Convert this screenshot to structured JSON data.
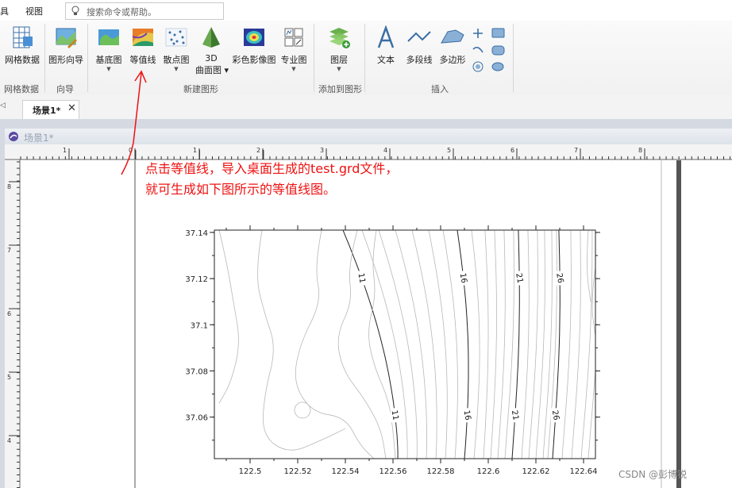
{
  "menu": {
    "item1": "具",
    "item2": "视图"
  },
  "search": {
    "placeholder": "搜索命令或帮助。"
  },
  "ribbon": {
    "grid_data": "网格数据",
    "graph_wizard": "图形向导",
    "basemap": "基底图",
    "contour": "等值线",
    "scatter": "散点图",
    "surface_line1": "3D",
    "surface_line2": "曲面图",
    "color_image": "彩色影像图",
    "special": "专业图",
    "layer": "图层",
    "text": "文本",
    "polyline": "多段线",
    "polygon": "多边形",
    "group_grid": "网格数据",
    "group_wizard": "向导",
    "group_new": "新建图形",
    "group_add": "添加到图形",
    "group_insert": "插入"
  },
  "tabs": {
    "active": "场景1*",
    "close": "✕"
  },
  "document": {
    "title": "场景1*"
  },
  "ruler": {
    "top_labels": [
      "1",
      "0",
      "1",
      "2",
      "3",
      "4",
      "5",
      "6",
      "7",
      "8"
    ],
    "left_labels": [
      "8",
      "7",
      "6",
      "5",
      "4"
    ]
  },
  "annotation": {
    "line1": "点击等值线，导入桌面生成的test.grd文件，",
    "line2": "就可生成如下图所示的等值线图。"
  },
  "chart_data": {
    "type": "contour",
    "x_ticks": [
      122.5,
      122.52,
      122.54,
      122.56,
      122.58,
      122.6,
      122.62,
      122.64
    ],
    "y_ticks": [
      37.06,
      37.08,
      37.1,
      37.12,
      37.14
    ],
    "xlim": [
      122.485,
      122.645
    ],
    "ylim": [
      37.042,
      37.141
    ],
    "labeled_levels": [
      "11",
      "16",
      "21",
      "26"
    ]
  },
  "watermark": "CSDN @彭博锐"
}
